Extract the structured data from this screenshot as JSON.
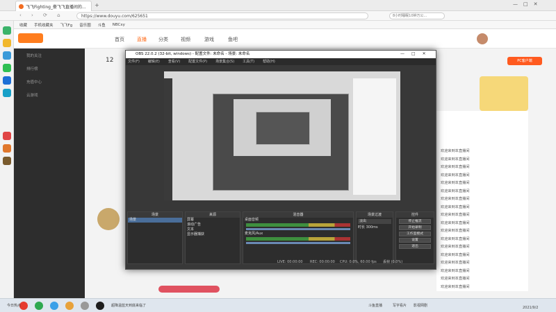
{
  "browser": {
    "tab_title": "飞飞Fighting_豪飞飞直播间的...",
    "url": "https://www.douyu.com/625651",
    "search_hint": "8小时睡眠10钟万公...",
    "bookmarks": [
      "收藏",
      "手机收藏夹",
      "飞飞Fg",
      "音乐圈",
      "斗鱼",
      "NBCxy"
    ]
  },
  "site": {
    "nav": [
      "首页",
      "直播",
      "分类",
      "视频",
      "游戏",
      "鱼吧"
    ],
    "side_items": [
      "我的关注",
      "排行榜",
      "充值中心",
      "云游戏"
    ],
    "feed_rows": [
      {
        "user": "",
        "msg": "欢迎来到本直播间"
      },
      {
        "user": "",
        "msg": "欢迎来到本直播间"
      },
      {
        "user": "",
        "msg": "欢迎来到本直播间"
      },
      {
        "user": "",
        "msg": "欢迎来到本直播间"
      },
      {
        "user": "",
        "msg": "欢迎来到本直播间"
      },
      {
        "user": "",
        "msg": "欢迎来到本直播间"
      },
      {
        "user": "",
        "msg": "欢迎来到本直播间"
      },
      {
        "user": "",
        "msg": "欢迎来到本直播间"
      },
      {
        "user": "",
        "msg": "欢迎来到本直播间"
      },
      {
        "user": "",
        "msg": "欢迎来到本直播间"
      },
      {
        "user": "",
        "msg": "欢迎来到本直播间"
      },
      {
        "user": "",
        "msg": "欢迎来到本直播间"
      },
      {
        "user": "",
        "msg": "欢迎来到本直播间"
      },
      {
        "user": "",
        "msg": "欢迎来到本直播间"
      },
      {
        "user": "",
        "msg": "欢迎来到本直播间"
      },
      {
        "user": "",
        "msg": "欢迎来到本直播间"
      },
      {
        "user": "",
        "msg": "欢迎来到本直播间"
      },
      {
        "user": "",
        "msg": "欢迎来到本直播间"
      }
    ]
  },
  "obs": {
    "title": "OBS 22.0.2 (32-bit, windows) - 配置文件: 未命名 - 场景: 未命名",
    "menu": [
      "文件(F)",
      "编辑(E)",
      "查看(V)",
      "配置文件(P)",
      "场景集合(S)",
      "工具(T)",
      "帮助(H)"
    ],
    "docks": {
      "scenes": {
        "title": "场景",
        "items": [
          "场景"
        ]
      },
      "sources": {
        "title": "来源",
        "items": [
          "屏幕",
          "滚动广告",
          "文本",
          "显示器捕获"
        ]
      },
      "mixer": {
        "title": "混音器",
        "tracks": [
          {
            "name": "桌面音频",
            "level": "0.0 dB"
          },
          {
            "name": "麦克风/Aux",
            "level": "0.0 dB"
          }
        ]
      },
      "transitions": {
        "title": "场景过渡",
        "type": "淡出",
        "duration_label": "时长",
        "duration": "300ms"
      },
      "controls": {
        "title": "控件",
        "buttons": [
          "停止推流",
          "开始录制",
          "工作室模式",
          "设置",
          "退出"
        ]
      }
    },
    "status": {
      "live": "LIVE: 00:00:00",
      "rec": "REC: 00:00:00",
      "cpu": "CPU: 0.0%, 60.00 fps",
      "dropped": "丢帧 (0.0%)"
    }
  },
  "taskbar": {
    "tickers": [
      "今日热点",
      "超降温蓝天到底来临了",
      "斗鱼直播",
      "写字看片",
      "影视网剧"
    ],
    "time": "2021/9/2"
  }
}
